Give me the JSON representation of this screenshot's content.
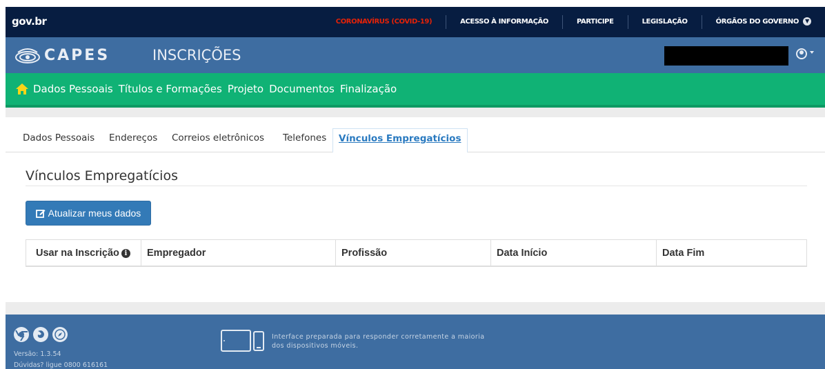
{
  "govbar": {
    "logo": "gov.br",
    "links": [
      "CORONAVÍRUS (COVID-19)",
      "ACESSO À INFORMAÇÃO",
      "PARTICIPE",
      "LEGISLAÇÃO",
      "ÓRGÃOS DO GOVERNO"
    ],
    "covid_color": "#e52207"
  },
  "header": {
    "logo": "CAPES",
    "title": "INSCRIÇÕES",
    "user_icon": "user-circle-icon"
  },
  "nav": {
    "home_icon": "home-icon",
    "items": [
      "Dados Pessoais",
      "Títulos e Formações",
      "Projeto",
      "Documentos",
      "Finalização"
    ]
  },
  "tabs": {
    "items": [
      "Dados Pessoais",
      "Endereços",
      "Correios eletrônicos",
      "Telefones",
      "Vínculos Empregatícios"
    ],
    "active": "Vínculos Empregatícios"
  },
  "main": {
    "title": "Vínculos Empregatícios",
    "update_button": "Atualizar meus dados",
    "update_icon": "edit-icon",
    "table_headers": [
      "Usar na Inscrição",
      "Empregador",
      "Profissão",
      "Data Início",
      "Data Fim"
    ],
    "info_icon": "info-icon"
  },
  "footer": {
    "browser_icons": [
      "chrome-icon",
      "firefox-icon",
      "safari-icon"
    ],
    "version": "Versão: 1.3.54",
    "help": "Dúvidas? ligue 0800 616161",
    "responsive_note": "Interface preparada para responder corretamente a maioria dos dispositivos móveis."
  },
  "colors": {
    "govbar": "#071d41",
    "capes_blue": "#3e6da1",
    "green_nav": "#10b275",
    "button_blue": "#337ab7",
    "active_tab": "#2a7ac0"
  }
}
